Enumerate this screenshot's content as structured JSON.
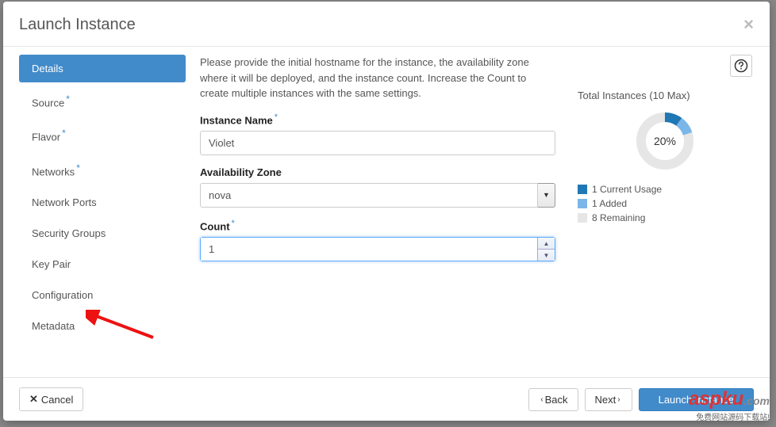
{
  "modal": {
    "title": "Launch Instance",
    "intro": "Please provide the initial hostname for the instance, the availability zone where it will be deployed, and the instance count. Increase the Count to create multiple instances with the same settings."
  },
  "sidebar": {
    "items": [
      {
        "label": "Details",
        "required": false,
        "active": true
      },
      {
        "label": "Source",
        "required": true,
        "active": false
      },
      {
        "label": "Flavor",
        "required": true,
        "active": false
      },
      {
        "label": "Networks",
        "required": true,
        "active": false
      },
      {
        "label": "Network Ports",
        "required": false,
        "active": false
      },
      {
        "label": "Security Groups",
        "required": false,
        "active": false
      },
      {
        "label": "Key Pair",
        "required": false,
        "active": false
      },
      {
        "label": "Configuration",
        "required": false,
        "active": false
      },
      {
        "label": "Metadata",
        "required": false,
        "active": false
      }
    ]
  },
  "form": {
    "instance_name": {
      "label": "Instance Name",
      "value": "Violet",
      "required": true
    },
    "availability_zone": {
      "label": "Availability Zone",
      "value": "nova",
      "required": false
    },
    "count": {
      "label": "Count",
      "value": "1",
      "required": true
    }
  },
  "stats": {
    "title": "Total Instances (10 Max)",
    "percent_label": "20%",
    "legend": [
      {
        "color": "#1f77b4",
        "text": "1 Current Usage"
      },
      {
        "color": "#7ab6e8",
        "text": "1 Added"
      },
      {
        "color": "#e6e6e6",
        "text": "8 Remaining"
      }
    ]
  },
  "chart_data": {
    "type": "pie",
    "title": "Total Instances (10 Max)",
    "categories": [
      "Current Usage",
      "Added",
      "Remaining"
    ],
    "values": [
      1,
      1,
      8
    ],
    "colors": [
      "#1f77b4",
      "#7ab6e8",
      "#e6e6e6"
    ],
    "total": 10,
    "center_label": "20%"
  },
  "footer": {
    "cancel": "Cancel",
    "back": "Back",
    "next": "Next",
    "launch": "Launch Instance"
  },
  "watermark": {
    "brand": "aspku",
    "domain": ".com",
    "sub": "免费网站源码下载站!"
  }
}
